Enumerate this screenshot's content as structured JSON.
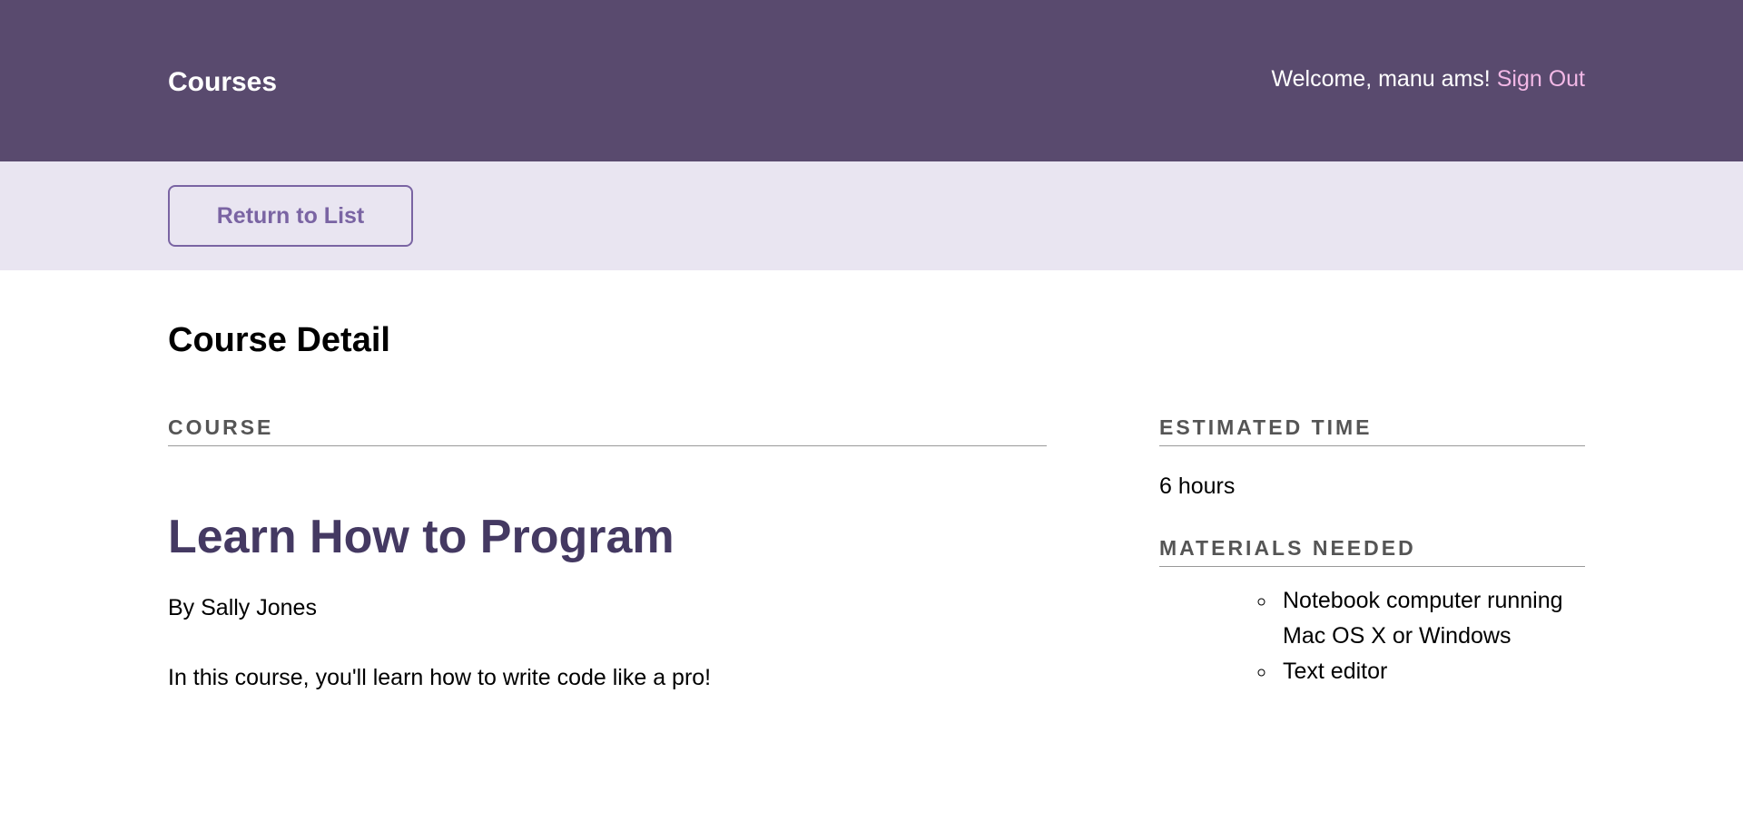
{
  "header": {
    "brand": "Courses",
    "welcome": "Welcome, manu ams!",
    "sign_out": "Sign Out"
  },
  "actions": {
    "return_label": "Return to List"
  },
  "main": {
    "page_title": "Course Detail",
    "course_section_label": "Course",
    "course_title": "Learn How to Program",
    "course_author": "By Sally Jones",
    "course_description": "In this course, you'll learn how to write code like a pro!",
    "estimated_time_label": "Estimated Time",
    "estimated_time": "6 hours",
    "materials_label": "Materials Needed",
    "materials": [
      "Notebook computer running Mac OS X or Windows",
      "Text editor"
    ]
  },
  "colors": {
    "header_bg": "#594a6e",
    "actions_bg": "#e9e5f1",
    "accent": "#7a64a3",
    "course_title": "#443962",
    "sign_out_link": "#f2b8e6"
  }
}
